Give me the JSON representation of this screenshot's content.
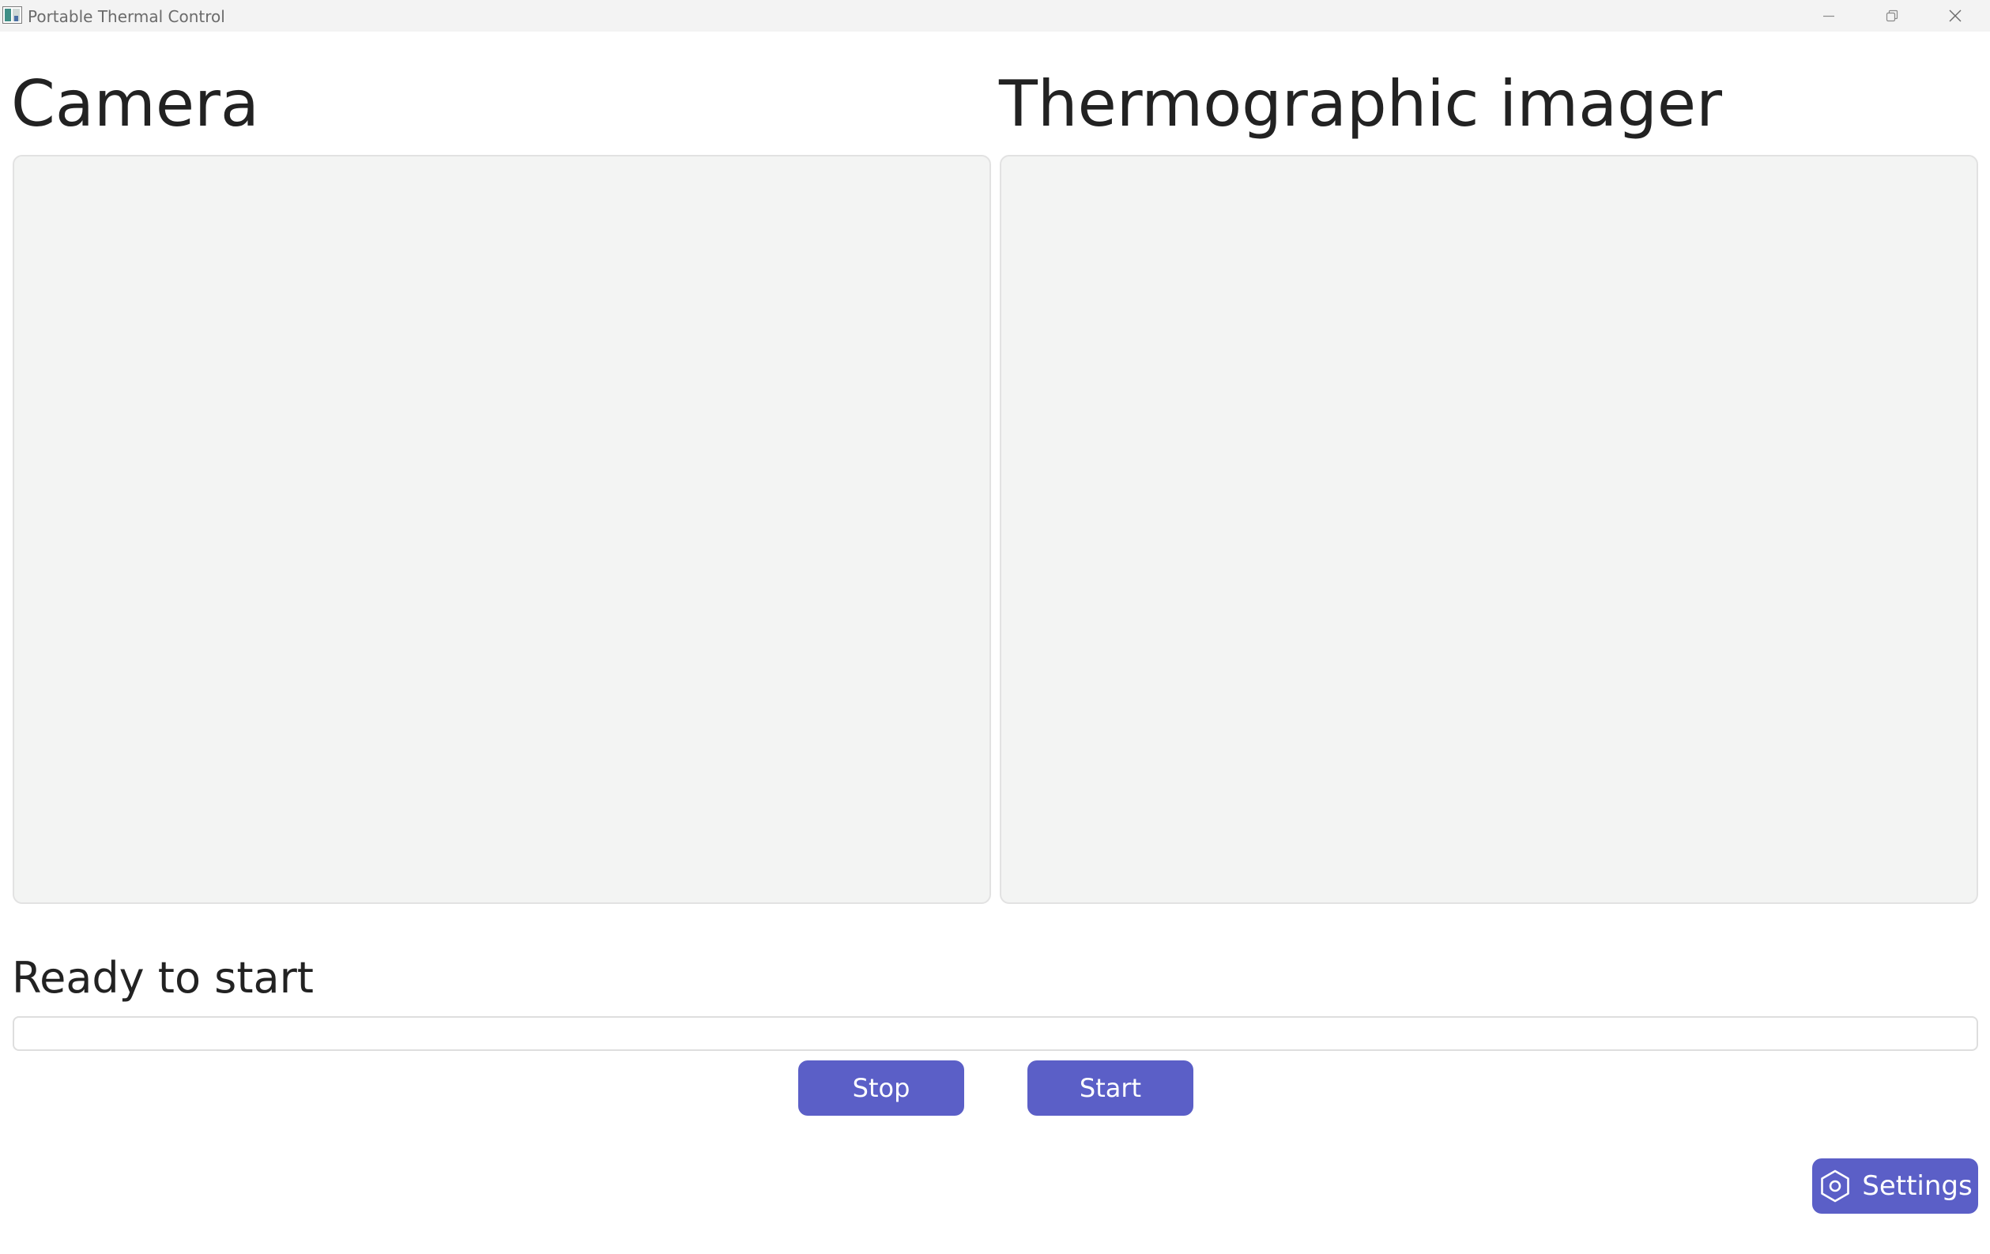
{
  "window": {
    "title": "Portable Thermal Control",
    "app_icon": "app-icon",
    "controls": [
      "minimize-icon",
      "restore-icon",
      "close-icon"
    ]
  },
  "camera": {
    "title": "Camera"
  },
  "thermal": {
    "title": "Thermographic imager"
  },
  "status": {
    "text": "Ready to start",
    "progress": 0
  },
  "buttons": {
    "stop_label": "Stop",
    "start_label": "Start",
    "settings_label": "Settings",
    "settings_icon": "hexagon-gear-icon"
  },
  "colors": {
    "accent": "#5b5fc7",
    "panel_bg": "#f3f4f3",
    "titlebar_bg": "#f3f3f3"
  }
}
